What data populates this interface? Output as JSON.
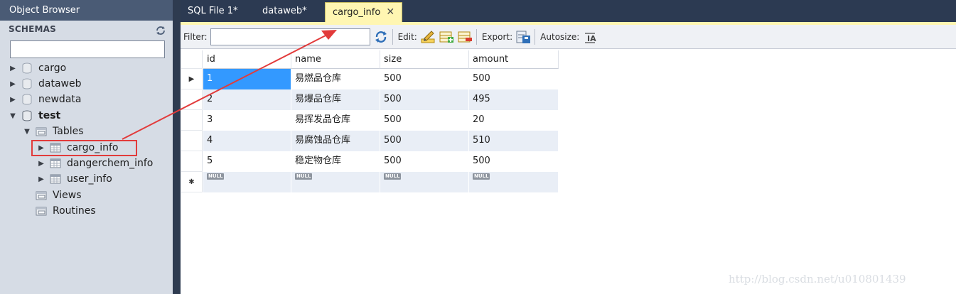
{
  "sidebar": {
    "title": "Object Browser",
    "schemas_label": "SCHEMAS",
    "search_value": "",
    "tree": [
      {
        "label": "cargo",
        "expanded": false,
        "bold": false
      },
      {
        "label": "dataweb",
        "expanded": false,
        "bold": false
      },
      {
        "label": "newdata",
        "expanded": false,
        "bold": false
      },
      {
        "label": "test",
        "expanded": true,
        "bold": true
      },
      {
        "label": "Tables",
        "expanded": true,
        "bold": false
      },
      {
        "label": "cargo_info",
        "expanded": false,
        "bold": false
      },
      {
        "label": "dangerchem_info",
        "expanded": false,
        "bold": false
      },
      {
        "label": "user_info",
        "expanded": false,
        "bold": false
      },
      {
        "label": "Views",
        "expanded": false,
        "bold": false
      },
      {
        "label": "Routines",
        "expanded": false,
        "bold": false
      }
    ]
  },
  "tabs": [
    {
      "label": "SQL File 1*",
      "active": false
    },
    {
      "label": "dataweb*",
      "active": false
    },
    {
      "label": "cargo_info",
      "active": true
    }
  ],
  "toolbar": {
    "filter_label": "Filter:",
    "filter_value": "",
    "edit_label": "Edit:",
    "export_label": "Export:",
    "autosize_label": "Autosize:"
  },
  "grid": {
    "columns": [
      "id",
      "name",
      "size",
      "amount"
    ],
    "rows": [
      [
        "1",
        "易燃品仓库",
        "500",
        "500"
      ],
      [
        "2",
        "易爆品仓库",
        "500",
        "495"
      ],
      [
        "3",
        "易挥发品仓库",
        "500",
        "20"
      ],
      [
        "4",
        "易腐蚀品仓库",
        "500",
        "510"
      ],
      [
        "5",
        "稳定物仓库",
        "500",
        "500"
      ]
    ],
    "null_label": "NULL",
    "current_row_marker": "▶",
    "new_row_marker": "✱"
  },
  "watermark": "http://blog.csdn.net/u010801439",
  "colors": {
    "annotation": "#e23b3b",
    "selection": "#3399ff",
    "active_tab": "#fff6b2",
    "sidebar_bg": "#d6dce5",
    "tabbar_bg": "#2c3a52"
  },
  "icons": {
    "refresh": "refresh-icon",
    "db": "database-icon",
    "folder": "folder-icon",
    "table": "table-icon"
  }
}
